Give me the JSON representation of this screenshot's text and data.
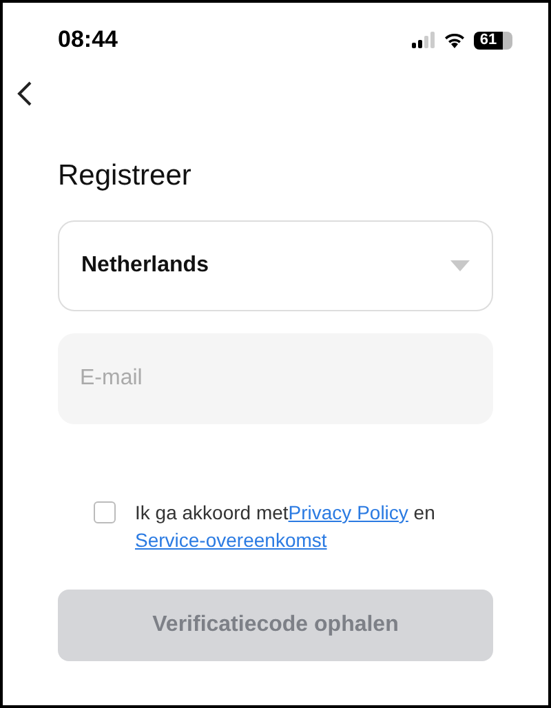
{
  "status_bar": {
    "time": "08:44",
    "battery": "61"
  },
  "title": "Registreer",
  "country_select": {
    "value": "Netherlands"
  },
  "email_field": {
    "placeholder": "E-mail"
  },
  "agreement": {
    "checked": false,
    "text": "Ik ga akkoord met",
    "link_1": "Privacy Policy",
    "joiner": " en ",
    "link_2": "Service-overeenkomst"
  },
  "submit_button": {
    "label": "Verificatiecode ophalen",
    "disabled": true
  }
}
